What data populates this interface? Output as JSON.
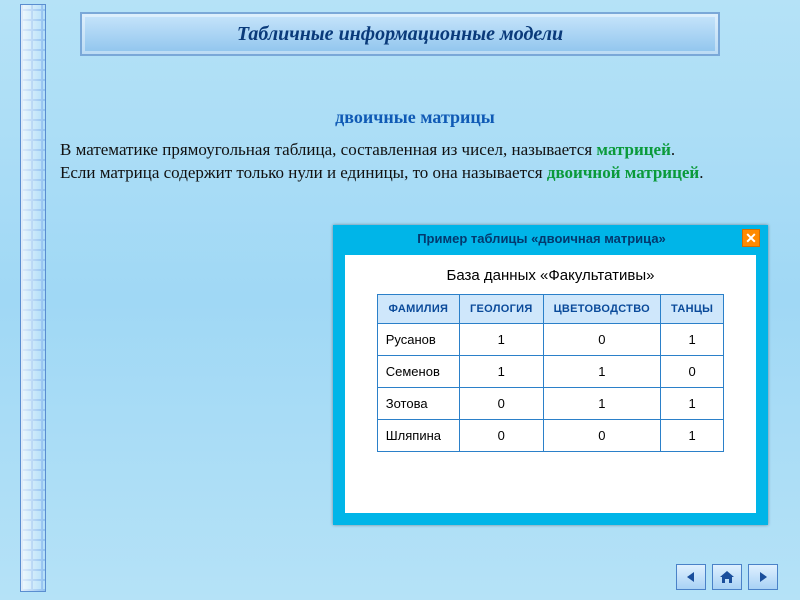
{
  "title": "Табличные информационные модели",
  "subheading": "двоичные матрицы",
  "para1_pre": "В математике прямоугольная таблица, составленная из чисел, называется ",
  "para1_hl": "матрицей",
  "para1_post": ".",
  "para2_pre": "Если матрица содержит только нули и единицы, то она называется ",
  "para2_hl": "двоичной матрицей",
  "para2_post": ".",
  "popup": {
    "title": "Пример таблицы «двоичная матрица»",
    "close": "✕",
    "caption": "База данных  «Факультативы»"
  },
  "headers": [
    "ФАМИЛИЯ",
    "ГЕОЛОГИЯ",
    "ЦВЕТОВОДСТВО",
    "ТАНЦЫ"
  ],
  "rows": [
    {
      "name": "Русанов",
      "v": [
        "1",
        "0",
        "1"
      ]
    },
    {
      "name": "Семенов",
      "v": [
        "1",
        "1",
        "0"
      ]
    },
    {
      "name": "Зотова",
      "v": [
        "0",
        "1",
        "1"
      ]
    },
    {
      "name": "Шляпина",
      "v": [
        "0",
        "0",
        "1"
      ]
    }
  ],
  "chart_data": {
    "type": "table",
    "title": "База данных «Факультативы»",
    "columns": [
      "ФАМИЛИЯ",
      "ГЕОЛОГИЯ",
      "ЦВЕТОВОДСТВО",
      "ТАНЦЫ"
    ],
    "rows": [
      [
        "Русанов",
        1,
        0,
        1
      ],
      [
        "Семенов",
        1,
        1,
        0
      ],
      [
        "Зотова",
        0,
        1,
        1
      ],
      [
        "Шляпина",
        0,
        0,
        1
      ]
    ]
  }
}
